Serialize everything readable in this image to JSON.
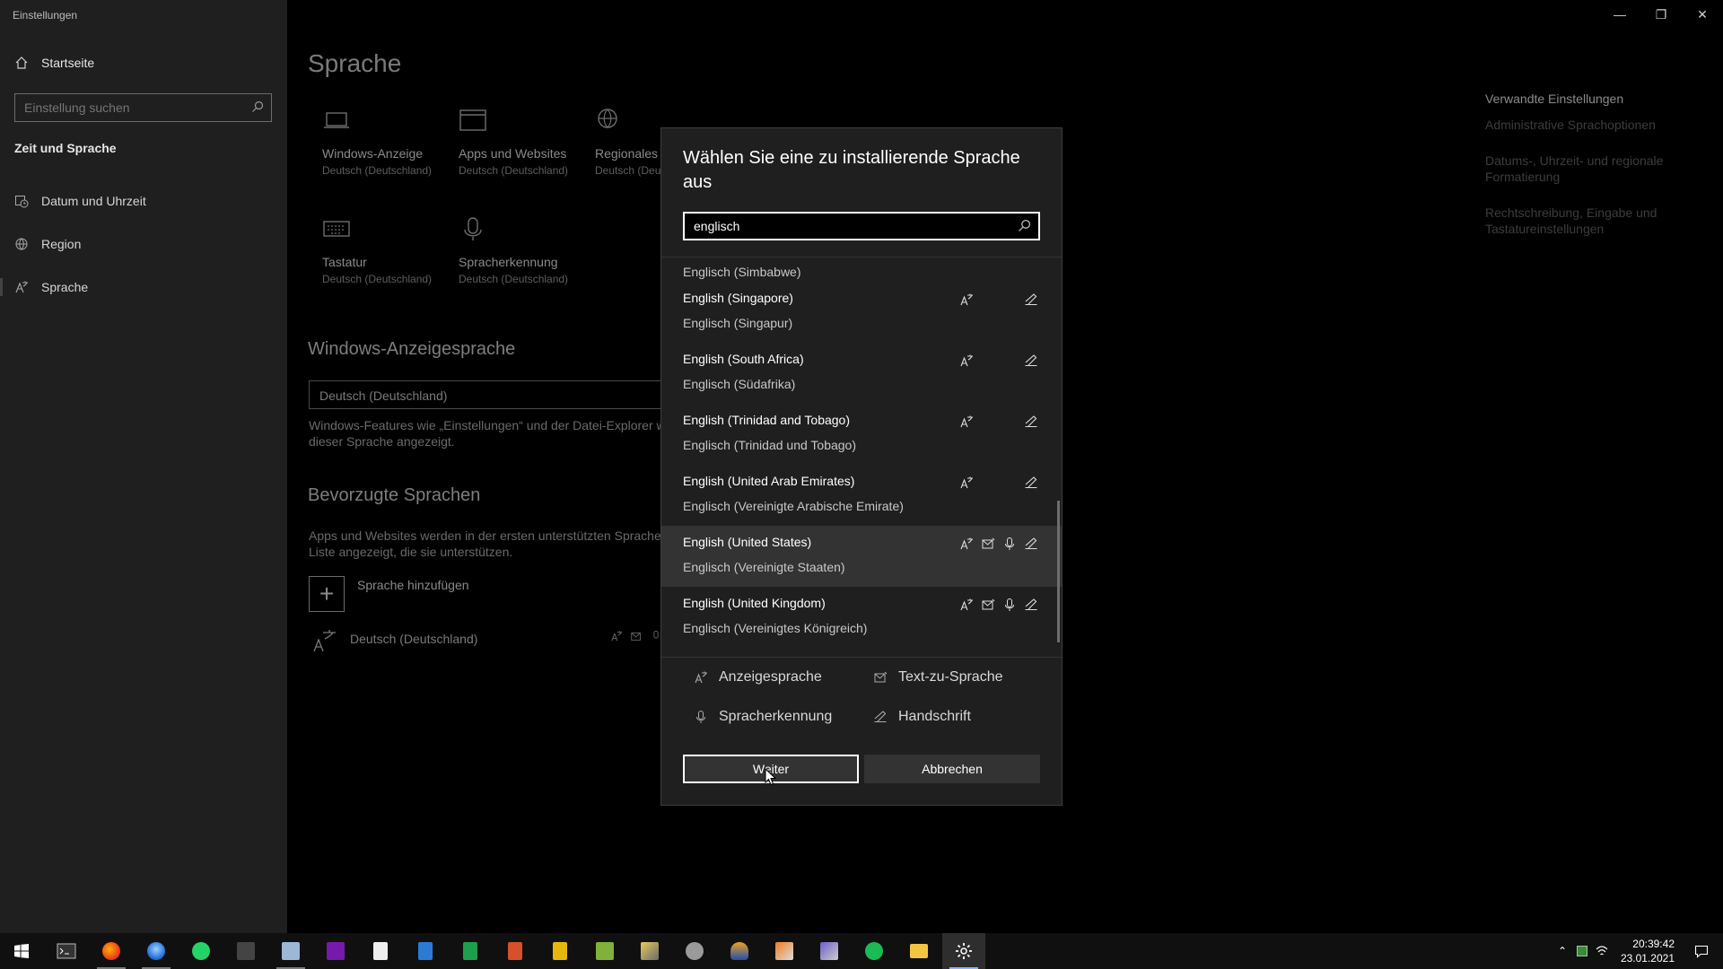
{
  "window": {
    "title": "Einstellungen",
    "minimize_glyph": "—",
    "restore_glyph": "❐",
    "close_glyph": "✕"
  },
  "sidebar": {
    "home_label": "Startseite",
    "search_placeholder": "Einstellung suchen",
    "section_title": "Zeit und Sprache",
    "items": [
      {
        "label": "Datum und Uhrzeit",
        "icon": "calendar-clock-icon"
      },
      {
        "label": "Region",
        "icon": "globe-icon"
      },
      {
        "label": "Sprache",
        "icon": "language-icon",
        "active": true
      }
    ]
  },
  "main": {
    "page_title": "Sprache",
    "tiles": [
      {
        "title": "Windows-Anzeige",
        "subtitle": "Deutsch (Deutschland)",
        "icon": "laptop-icon"
      },
      {
        "title": "Apps und Websites",
        "subtitle": "Deutsch (Deutschland)",
        "icon": "window-icon"
      },
      {
        "title": "Regionales F",
        "subtitle": "Deutsch (Deu",
        "icon": "globe-icon"
      },
      {
        "title": "Tastatur",
        "subtitle": "Deutsch (Deutschland)",
        "icon": "keyboard-icon"
      },
      {
        "title": "Spracherkennung",
        "subtitle": "Deutsch (Deutschland)",
        "icon": "microphone-icon"
      }
    ],
    "display_language_title": "Windows-Anzeigesprache",
    "display_language_value": "Deutsch (Deutschland)",
    "display_language_desc_1": "Windows-Features wie „Einstellungen“ und der Datei-Explorer w",
    "display_language_desc_2": "dieser Sprache angezeigt.",
    "preferred_title": "Bevorzugte Sprachen",
    "preferred_desc_1": "Apps und Websites werden in der ersten unterstützten Sprache",
    "preferred_desc_2": "Liste angezeigt, die sie unterstützen.",
    "add_language_label": "Sprache hinzufügen",
    "installed_language": "Deutsch (Deutschland)"
  },
  "related": {
    "title": "Verwandte Einstellungen",
    "links": [
      "Administrative Sprachoptionen",
      "Datums-, Uhrzeit- und regionale Formatierung",
      "Rechtschreibung, Eingabe und Tastatureinstellungen"
    ]
  },
  "dialog": {
    "title": "Wählen Sie eine zu installierende Sprache aus",
    "search_value": "englisch",
    "partial_item": "Englisch (Simbabwe)",
    "items": [
      {
        "primary": "English (Singapore)",
        "secondary": "Englisch (Singapur)",
        "features": [
          "display",
          "handwriting"
        ]
      },
      {
        "primary": "English (South Africa)",
        "secondary": "Englisch (Südafrika)",
        "features": [
          "display",
          "handwriting"
        ]
      },
      {
        "primary": "English (Trinidad and Tobago)",
        "secondary": "Englisch (Trinidad und Tobago)",
        "features": [
          "display",
          "handwriting"
        ]
      },
      {
        "primary": "English (United Arab Emirates)",
        "secondary": "Englisch (Vereinigte Arabische Emirate)",
        "features": [
          "display",
          "handwriting"
        ]
      },
      {
        "primary": "English (United States)",
        "secondary": "Englisch (Vereinigte Staaten)",
        "features": [
          "display",
          "tts",
          "speech",
          "handwriting"
        ],
        "selected": true
      },
      {
        "primary": "English (United Kingdom)",
        "secondary": "Englisch (Vereinigtes Königreich)",
        "features": [
          "display",
          "tts",
          "speech",
          "handwriting"
        ]
      }
    ],
    "legend": {
      "display": "Anzeigesprache",
      "tts": "Text-zu-Sprache",
      "speech": "Spracherkennung",
      "handwriting": "Handschrift"
    },
    "next_button": "Weiter",
    "cancel_button": "Abbrechen"
  },
  "taskbar": {
    "apps": [
      "terminal-icon",
      "firefox-icon",
      "thunderbird-icon",
      "whatsapp-icon",
      "app-icon",
      "notepad-icon",
      "onenote-icon",
      "file-icon",
      "writer-icon",
      "calc-icon",
      "impress-icon",
      "draw-icon",
      "sheet-icon",
      "pen-icon",
      "shield-icon",
      "remote-icon",
      "tools-icon",
      "ruler-icon",
      "spotify-icon",
      "explorer-icon",
      "settings-icon"
    ],
    "time": "20:39:42",
    "date": "23.01.2021"
  },
  "colors": {
    "accent": "#8ab4f8",
    "dialog_bg": "#1f1f1f",
    "selected_row": "#333333"
  }
}
